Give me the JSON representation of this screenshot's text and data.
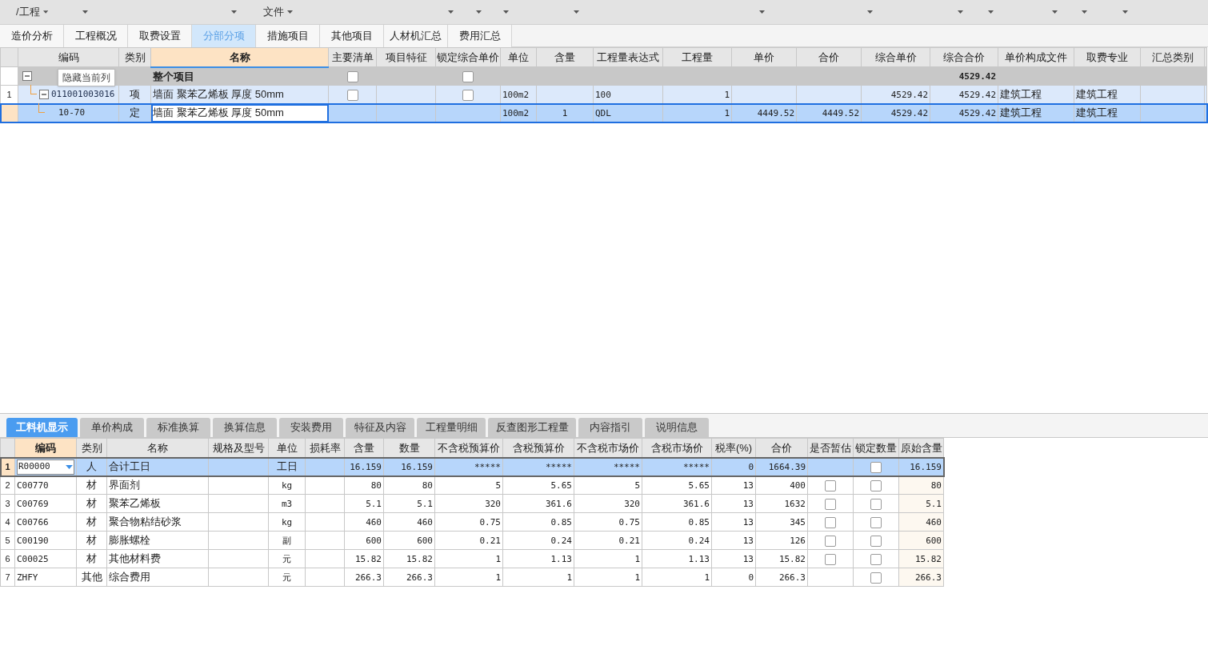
{
  "toolbar": {
    "items": [
      {
        "label": "/工程",
        "dropdown": true
      },
      {
        "dropdown": true
      },
      {
        "dropdown": true
      },
      {
        "label": "文件",
        "dropdown": true
      },
      {
        "dropdown": true
      },
      {
        "dropdown": true
      },
      {
        "dropdown": true
      },
      {
        "dropdown": true
      },
      {
        "dropdown": true
      },
      {
        "dropdown": true
      },
      {
        "dropdown": true
      },
      {
        "dropdown": true
      },
      {
        "dropdown": true
      },
      {
        "dropdown": true
      },
      {
        "dropdown": true
      }
    ]
  },
  "tabs": [
    {
      "label": "造价分析",
      "selected": false
    },
    {
      "label": "工程概况",
      "selected": false
    },
    {
      "label": "取费设置",
      "selected": false
    },
    {
      "label": "分部分项",
      "selected": true
    },
    {
      "label": "措施项目",
      "selected": false
    },
    {
      "label": "其他项目",
      "selected": false
    },
    {
      "label": "人材机汇总",
      "selected": false
    },
    {
      "label": "费用汇总",
      "selected": false
    }
  ],
  "upper_table": {
    "columns": [
      {
        "label": "编码",
        "selected": false
      },
      {
        "label": "类别",
        "selected": false
      },
      {
        "label": "名称",
        "selected": true
      },
      {
        "label": "主要清单",
        "selected": false
      },
      {
        "label": "项目特征",
        "selected": false
      },
      {
        "label": "锁定综合单价",
        "selected": false
      },
      {
        "label": "单位",
        "selected": false
      },
      {
        "label": "含量",
        "selected": false
      },
      {
        "label": "工程量表达式",
        "selected": false
      },
      {
        "label": "工程量",
        "selected": false
      },
      {
        "label": "单价",
        "selected": false
      },
      {
        "label": "合价",
        "selected": false
      },
      {
        "label": "综合单价",
        "selected": false
      },
      {
        "label": "综合合价",
        "selected": false
      },
      {
        "label": "单价构成文件",
        "selected": false
      },
      {
        "label": "取费专业",
        "selected": false
      },
      {
        "label": "汇总类别",
        "selected": false
      }
    ],
    "rows": [
      {
        "kind": "root",
        "selected": false,
        "expanded": true,
        "cells": [
          null,
          null,
          "整个项目",
          {
            "checked": false
          },
          null,
          {
            "checked": false
          },
          null,
          null,
          null,
          null,
          null,
          null,
          null,
          "4529.42",
          null,
          null,
          null
        ],
        "children": [
          {
            "kind": "list",
            "row_number": "1",
            "selected": false,
            "expanded": true,
            "cells": [
              "011001003016",
              "项",
              "墙面 聚苯乙烯板 厚度 50mm",
              {
                "checked": false
              },
              null,
              {
                "checked": false
              },
              "100m2",
              null,
              "100",
              "1",
              null,
              null,
              "4529.42",
              "4529.42",
              "建筑工程",
              "建筑工程",
              null
            ],
            "children": [
              {
                "kind": "quota",
                "selected": true,
                "cells": [
                  "10-70",
                  "定",
                  "墙面 聚苯乙烯板 厚度 50mm",
                  null,
                  null,
                  null,
                  "100m2",
                  "1",
                  "QDL",
                  "1",
                  "4449.52",
                  "4449.52",
                  "4529.42",
                  "4529.42",
                  "建筑工程",
                  "建筑工程",
                  null
                ]
              }
            ]
          }
        ]
      }
    ]
  },
  "tooltip": {
    "text": "隐藏当前列"
  },
  "bottom_tabs": [
    {
      "label": "工料机显示",
      "selected": true
    },
    {
      "label": "单价构成",
      "selected": false
    },
    {
      "label": "标准换算",
      "selected": false
    },
    {
      "label": "换算信息",
      "selected": false
    },
    {
      "label": "安装费用",
      "selected": false
    },
    {
      "label": "特征及内容",
      "selected": false
    },
    {
      "label": "工程量明细",
      "selected": false
    },
    {
      "label": "反查图形工程量",
      "selected": false
    },
    {
      "label": "内容指引",
      "selected": false
    },
    {
      "label": "说明信息",
      "selected": false
    }
  ],
  "lower_table": {
    "columns": [
      {
        "label": "编码",
        "selected": true
      },
      {
        "label": "类别",
        "selected": false
      },
      {
        "label": "名称",
        "selected": false
      },
      {
        "label": "规格及型号",
        "selected": false
      },
      {
        "label": "单位",
        "selected": false
      },
      {
        "label": "损耗率",
        "selected": false
      },
      {
        "label": "含量",
        "selected": false
      },
      {
        "label": "数量",
        "selected": false
      },
      {
        "label": "不含税预算价",
        "selected": false
      },
      {
        "label": "含税预算价",
        "selected": false
      },
      {
        "label": "不含税市场价",
        "selected": false
      },
      {
        "label": "含税市场价",
        "selected": false
      },
      {
        "label": "税率(%)",
        "selected": false
      },
      {
        "label": "合价",
        "selected": false
      },
      {
        "label": "是否暂估",
        "selected": false
      },
      {
        "label": "锁定数量",
        "selected": false
      },
      {
        "label": "原始含量",
        "selected": false
      }
    ],
    "rows": [
      {
        "row_number": "1",
        "selected": true,
        "cells": [
          "R00000",
          "人",
          "合计工日",
          null,
          "工日",
          null,
          "16.159",
          "16.159",
          "*****",
          "*****",
          "*****",
          "*****",
          "0",
          "1664.39",
          null,
          {
            "checked": false
          },
          "16.159"
        ]
      },
      {
        "row_number": "2",
        "selected": false,
        "cells": [
          "C00770",
          "材",
          "界面剂",
          null,
          "kg",
          null,
          "80",
          "80",
          "5",
          "5.65",
          "5",
          "5.65",
          "13",
          "400",
          {
            "checked": false
          },
          {
            "checked": false
          },
          "80"
        ]
      },
      {
        "row_number": "3",
        "selected": false,
        "cells": [
          "C00769",
          "材",
          "聚苯乙烯板",
          null,
          "m3",
          null,
          "5.1",
          "5.1",
          "320",
          "361.6",
          "320",
          "361.6",
          "13",
          "1632",
          {
            "checked": false
          },
          {
            "checked": false
          },
          "5.1"
        ]
      },
      {
        "row_number": "4",
        "selected": false,
        "cells": [
          "C00766",
          "材",
          "聚合物粘结砂浆",
          null,
          "kg",
          null,
          "460",
          "460",
          "0.75",
          "0.85",
          "0.75",
          "0.85",
          "13",
          "345",
          {
            "checked": false
          },
          {
            "checked": false
          },
          "460"
        ]
      },
      {
        "row_number": "5",
        "selected": false,
        "cells": [
          "C00190",
          "材",
          "膨胀螺栓",
          null,
          "副",
          null,
          "600",
          "600",
          "0.21",
          "0.24",
          "0.21",
          "0.24",
          "13",
          "126",
          {
            "checked": false
          },
          {
            "checked": false
          },
          "600"
        ]
      },
      {
        "row_number": "6",
        "selected": false,
        "cells": [
          "C00025",
          "材",
          "其他材料费",
          null,
          "元",
          null,
          "15.82",
          "15.82",
          "1",
          "1.13",
          "1",
          "1.13",
          "13",
          "15.82",
          {
            "checked": false
          },
          {
            "checked": false
          },
          "15.82"
        ]
      },
      {
        "row_number": "7",
        "selected": false,
        "cells": [
          "ZHFY",
          "其他",
          "综合费用",
          null,
          "元",
          null,
          "266.3",
          "266.3",
          "1",
          "1",
          "1",
          "1",
          "0",
          "266.3",
          null,
          {
            "checked": false
          },
          "266.3"
        ]
      }
    ]
  }
}
